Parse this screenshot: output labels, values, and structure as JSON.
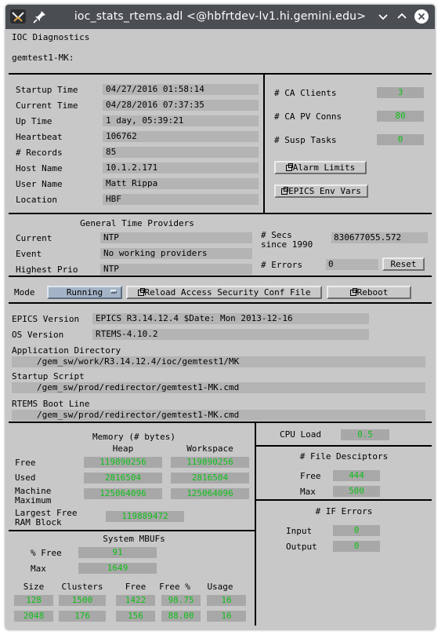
{
  "window": {
    "title": "ioc_stats_rtems.adl  <@hbfrtdev-lv1.hi.gemini.edu>"
  },
  "header": {
    "title": "IOC Diagnostics",
    "ioc": "gemtest1-MK:"
  },
  "info": [
    {
      "label": "Startup Time",
      "value": "04/27/2016 01:58:14"
    },
    {
      "label": "Current Time",
      "value": "04/28/2016 07:37:35"
    },
    {
      "label": "Up Time",
      "value": "1 day, 05:39:21"
    },
    {
      "label": "Heartbeat",
      "value": "106762"
    },
    {
      "label": "# Records",
      "value": "85"
    },
    {
      "label": "Host Name",
      "value": "10.1.2.171"
    },
    {
      "label": "User Name",
      "value": "Matt Rippa"
    },
    {
      "label": "Location",
      "value": "HBF"
    }
  ],
  "ca": {
    "clients_label": "# CA Clients",
    "clients": "3",
    "pv_label": "# CA PV Conns",
    "pv": "80",
    "susp_label": "# Susp Tasks",
    "susp": "0",
    "alarm_button": "Alarm Limits",
    "env_button": "EPICS Env Vars"
  },
  "time": {
    "heading": "General Time Providers",
    "current_label": "Current",
    "current": "NTP",
    "event_label": "Event",
    "event": "No working providers",
    "highest_label": "Highest Prio",
    "highest": "NTP",
    "secs_label1": "# Secs",
    "secs_label2": "since 1990",
    "secs": "830677055.572",
    "errors_label": "# Errors",
    "errors": "0",
    "reset_button": "Reset"
  },
  "mode": {
    "label": "Mode",
    "selected": "Running",
    "reload_button": "Reload Access Security Conf File",
    "reboot_button": "Reboot"
  },
  "versions": {
    "epics_label": "EPICS Version",
    "epics": "EPICS R3.14.12.4 $Date: Mon 2013-12-16",
    "os_label": "OS Version",
    "os": "RTEMS-4.10.2",
    "appdir_label": "Application Directory",
    "appdir": "/gem_sw/work/R3.14.12.4/ioc/gemtest1/MK",
    "startup_label": "Startup Script",
    "startup": "/gem_sw/prod/redirector/gemtest1-MK.cmd",
    "boot_label": "RTEMS Boot Line",
    "boot": "/gem_sw/prod/redirector/gemtest1-MK.cmd"
  },
  "memory": {
    "heading": "Memory (# bytes)",
    "heap_col": "Heap",
    "work_col": "Workspace",
    "free_label": "Free",
    "free_heap": "119890256",
    "free_work": "119890256",
    "used_label": "Used",
    "used_heap": "2816504",
    "used_work": "2816504",
    "max_label1": "Machine",
    "max_label2": "Maximum",
    "max_heap": "125064096",
    "max_work": "125064096",
    "largest_label1": "Largest Free",
    "largest_label2": "RAM Block",
    "largest": "119889472"
  },
  "mbufs": {
    "heading": "System MBUFs",
    "pfree_label": "% Free",
    "pfree": "91",
    "max_label": "Max",
    "max": "1649",
    "cols": [
      "Size",
      "Clusters",
      "Free",
      "Free %",
      "Usage"
    ],
    "rows": [
      [
        "128",
        "1500",
        "1422",
        "98.75",
        "16"
      ],
      [
        "2048",
        "176",
        "156",
        "88.00",
        "16"
      ]
    ]
  },
  "cpu": {
    "label": "CPU Load",
    "value": "0.5"
  },
  "fd": {
    "heading": "# File Desciptors",
    "free_label": "Free",
    "free": "444",
    "max_label": "Max",
    "max": "500"
  },
  "iferr": {
    "heading": "# IF Errors",
    "input_label": "Input",
    "input": "0",
    "output_label": "Output",
    "output": "0"
  },
  "colors": {
    "titlebar": "#4a4d52",
    "panel": "#c8c8c8",
    "field": "#b4b4b4",
    "monitor_text": "#0fbf19",
    "menu": "#a4b4c6"
  }
}
